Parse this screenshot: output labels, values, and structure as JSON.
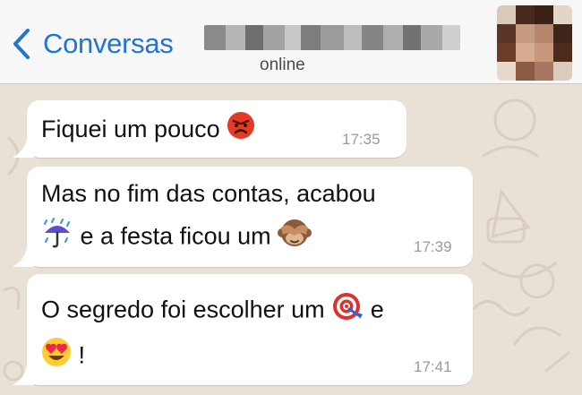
{
  "header": {
    "back_label": "Conversas",
    "status": "online"
  },
  "messages": [
    {
      "line1": "Fiquei um pouco",
      "time": "17:35"
    },
    {
      "line1": "Mas no fim das contas, acabou",
      "line2": "e a festa ficou um",
      "time": "17:39"
    },
    {
      "line1": "O segredo foi escolher um",
      "line1_end": "e",
      "line2": "!",
      "time": "17:41"
    }
  ],
  "icons": {
    "back": "chevron-left-icon",
    "emoji_1": "angry-face-emoji",
    "emoji_2": "umbrella-rain-emoji",
    "emoji_3": "see-no-evil-monkey-emoji",
    "emoji_4": "target-emoji",
    "emoji_5": "heart-eyes-emoji"
  },
  "colors": {
    "accent": "#1f74d4",
    "bubble": "#ffffff",
    "wallpaper": "#e9e1d5"
  }
}
